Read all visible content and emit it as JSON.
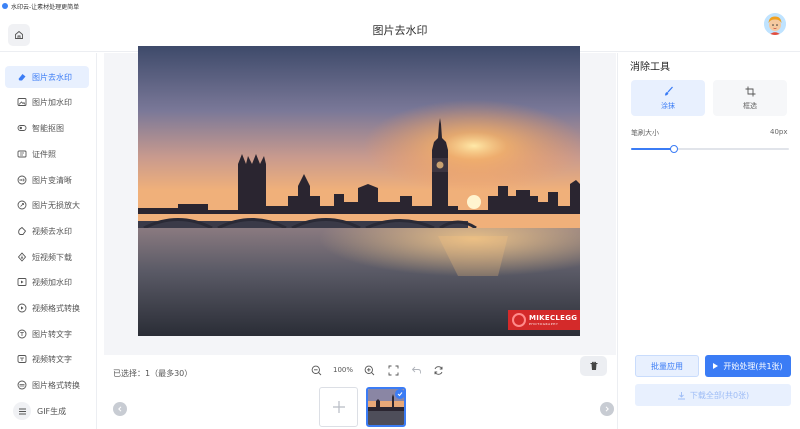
{
  "window": {
    "title": "水印云-让素材处理更简单"
  },
  "header": {
    "title": "图片去水印"
  },
  "sidebar": {
    "items": [
      {
        "label": "图片去水印",
        "icon": "eraser-icon",
        "active": true
      },
      {
        "label": "图片加水印",
        "icon": "image-add-icon",
        "active": false
      },
      {
        "label": "智能抠图",
        "icon": "cutout-icon",
        "active": false
      },
      {
        "label": "证件照",
        "icon": "id-card-icon",
        "active": false
      },
      {
        "label": "图片变清晰",
        "icon": "hd-icon",
        "active": false
      },
      {
        "label": "图片无损放大",
        "icon": "magnify-icon",
        "active": false
      },
      {
        "label": "视频去水印",
        "icon": "video-eraser-icon",
        "active": false
      },
      {
        "label": "短视频下载",
        "icon": "download-icon",
        "active": false
      },
      {
        "label": "视频加水印",
        "icon": "video-add-icon",
        "active": false
      },
      {
        "label": "视频格式转换",
        "icon": "video-convert-icon",
        "active": false
      },
      {
        "label": "图片转文字",
        "icon": "image-text-icon",
        "active": false
      },
      {
        "label": "视频转文字",
        "icon": "video-text-icon",
        "active": false
      },
      {
        "label": "图片格式转换",
        "icon": "image-convert-icon",
        "active": false
      },
      {
        "label": "GIF生成",
        "icon": "menu-icon",
        "active": false
      }
    ]
  },
  "canvas": {
    "watermark_text": "MIKECLEGG",
    "watermark_subtext": "PHOTOGRAPHY"
  },
  "status": {
    "selected": "已选择：1（最多30）",
    "zoom": "100%"
  },
  "panel": {
    "title": "消除工具",
    "tools": [
      {
        "label": "涂抹",
        "icon": "brush-icon",
        "active": true
      },
      {
        "label": "框选",
        "icon": "crop-icon",
        "active": false
      }
    ],
    "brush_size_label": "笔刷大小",
    "brush_size_value": "40px",
    "brush_slider_fraction": 0.27,
    "batch_apply": "批量应用",
    "start_process": "开始处理(共1张)",
    "download_all": "下载全部(共0张)"
  },
  "colors": {
    "accent": "#3b7cf5",
    "accent_light": "#e8f0fe",
    "watermark": "#d42a2a"
  }
}
